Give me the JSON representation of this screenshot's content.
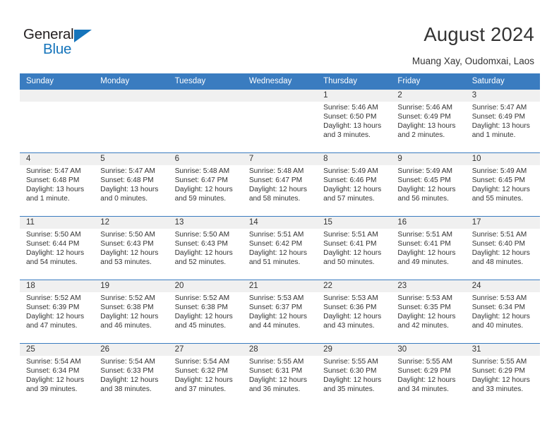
{
  "brand": {
    "name_top": "General",
    "name_bottom": "Blue",
    "accent_color": "#1574bb",
    "triangle_icon": "triangle-logo-icon"
  },
  "header": {
    "title": "August 2024",
    "subtitle": "Muang Xay, Oudomxai, Laos"
  },
  "theme": {
    "header_bg": "#3a7cc0",
    "daynum_band_bg": "#f0f0f0",
    "text": "#333333",
    "row_divider": "#3a7cc0"
  },
  "weekday_headers": [
    "Sunday",
    "Monday",
    "Tuesday",
    "Wednesday",
    "Thursday",
    "Friday",
    "Saturday"
  ],
  "labels": {
    "sunrise_prefix": "Sunrise:",
    "sunset_prefix": "Sunset:",
    "daylight_prefix": "Daylight:"
  },
  "weeks": [
    [
      {
        "day": "",
        "sunrise": "",
        "sunset": "",
        "daylight": "",
        "empty": true
      },
      {
        "day": "",
        "sunrise": "",
        "sunset": "",
        "daylight": "",
        "empty": true
      },
      {
        "day": "",
        "sunrise": "",
        "sunset": "",
        "daylight": "",
        "empty": true
      },
      {
        "day": "",
        "sunrise": "",
        "sunset": "",
        "daylight": "",
        "empty": true
      },
      {
        "day": "1",
        "sunrise": "Sunrise: 5:46 AM",
        "sunset": "Sunset: 6:50 PM",
        "daylight": "Daylight: 13 hours and 3 minutes.",
        "empty": false
      },
      {
        "day": "2",
        "sunrise": "Sunrise: 5:46 AM",
        "sunset": "Sunset: 6:49 PM",
        "daylight": "Daylight: 13 hours and 2 minutes.",
        "empty": false
      },
      {
        "day": "3",
        "sunrise": "Sunrise: 5:47 AM",
        "sunset": "Sunset: 6:49 PM",
        "daylight": "Daylight: 13 hours and 1 minute.",
        "empty": false
      }
    ],
    [
      {
        "day": "4",
        "sunrise": "Sunrise: 5:47 AM",
        "sunset": "Sunset: 6:48 PM",
        "daylight": "Daylight: 13 hours and 1 minute.",
        "empty": false
      },
      {
        "day": "5",
        "sunrise": "Sunrise: 5:47 AM",
        "sunset": "Sunset: 6:48 PM",
        "daylight": "Daylight: 13 hours and 0 minutes.",
        "empty": false
      },
      {
        "day": "6",
        "sunrise": "Sunrise: 5:48 AM",
        "sunset": "Sunset: 6:47 PM",
        "daylight": "Daylight: 12 hours and 59 minutes.",
        "empty": false
      },
      {
        "day": "7",
        "sunrise": "Sunrise: 5:48 AM",
        "sunset": "Sunset: 6:47 PM",
        "daylight": "Daylight: 12 hours and 58 minutes.",
        "empty": false
      },
      {
        "day": "8",
        "sunrise": "Sunrise: 5:49 AM",
        "sunset": "Sunset: 6:46 PM",
        "daylight": "Daylight: 12 hours and 57 minutes.",
        "empty": false
      },
      {
        "day": "9",
        "sunrise": "Sunrise: 5:49 AM",
        "sunset": "Sunset: 6:45 PM",
        "daylight": "Daylight: 12 hours and 56 minutes.",
        "empty": false
      },
      {
        "day": "10",
        "sunrise": "Sunrise: 5:49 AM",
        "sunset": "Sunset: 6:45 PM",
        "daylight": "Daylight: 12 hours and 55 minutes.",
        "empty": false
      }
    ],
    [
      {
        "day": "11",
        "sunrise": "Sunrise: 5:50 AM",
        "sunset": "Sunset: 6:44 PM",
        "daylight": "Daylight: 12 hours and 54 minutes.",
        "empty": false
      },
      {
        "day": "12",
        "sunrise": "Sunrise: 5:50 AM",
        "sunset": "Sunset: 6:43 PM",
        "daylight": "Daylight: 12 hours and 53 minutes.",
        "empty": false
      },
      {
        "day": "13",
        "sunrise": "Sunrise: 5:50 AM",
        "sunset": "Sunset: 6:43 PM",
        "daylight": "Daylight: 12 hours and 52 minutes.",
        "empty": false
      },
      {
        "day": "14",
        "sunrise": "Sunrise: 5:51 AM",
        "sunset": "Sunset: 6:42 PM",
        "daylight": "Daylight: 12 hours and 51 minutes.",
        "empty": false
      },
      {
        "day": "15",
        "sunrise": "Sunrise: 5:51 AM",
        "sunset": "Sunset: 6:41 PM",
        "daylight": "Daylight: 12 hours and 50 minutes.",
        "empty": false
      },
      {
        "day": "16",
        "sunrise": "Sunrise: 5:51 AM",
        "sunset": "Sunset: 6:41 PM",
        "daylight": "Daylight: 12 hours and 49 minutes.",
        "empty": false
      },
      {
        "day": "17",
        "sunrise": "Sunrise: 5:51 AM",
        "sunset": "Sunset: 6:40 PM",
        "daylight": "Daylight: 12 hours and 48 minutes.",
        "empty": false
      }
    ],
    [
      {
        "day": "18",
        "sunrise": "Sunrise: 5:52 AM",
        "sunset": "Sunset: 6:39 PM",
        "daylight": "Daylight: 12 hours and 47 minutes.",
        "empty": false
      },
      {
        "day": "19",
        "sunrise": "Sunrise: 5:52 AM",
        "sunset": "Sunset: 6:38 PM",
        "daylight": "Daylight: 12 hours and 46 minutes.",
        "empty": false
      },
      {
        "day": "20",
        "sunrise": "Sunrise: 5:52 AM",
        "sunset": "Sunset: 6:38 PM",
        "daylight": "Daylight: 12 hours and 45 minutes.",
        "empty": false
      },
      {
        "day": "21",
        "sunrise": "Sunrise: 5:53 AM",
        "sunset": "Sunset: 6:37 PM",
        "daylight": "Daylight: 12 hours and 44 minutes.",
        "empty": false
      },
      {
        "day": "22",
        "sunrise": "Sunrise: 5:53 AM",
        "sunset": "Sunset: 6:36 PM",
        "daylight": "Daylight: 12 hours and 43 minutes.",
        "empty": false
      },
      {
        "day": "23",
        "sunrise": "Sunrise: 5:53 AM",
        "sunset": "Sunset: 6:35 PM",
        "daylight": "Daylight: 12 hours and 42 minutes.",
        "empty": false
      },
      {
        "day": "24",
        "sunrise": "Sunrise: 5:53 AM",
        "sunset": "Sunset: 6:34 PM",
        "daylight": "Daylight: 12 hours and 40 minutes.",
        "empty": false
      }
    ],
    [
      {
        "day": "25",
        "sunrise": "Sunrise: 5:54 AM",
        "sunset": "Sunset: 6:34 PM",
        "daylight": "Daylight: 12 hours and 39 minutes.",
        "empty": false
      },
      {
        "day": "26",
        "sunrise": "Sunrise: 5:54 AM",
        "sunset": "Sunset: 6:33 PM",
        "daylight": "Daylight: 12 hours and 38 minutes.",
        "empty": false
      },
      {
        "day": "27",
        "sunrise": "Sunrise: 5:54 AM",
        "sunset": "Sunset: 6:32 PM",
        "daylight": "Daylight: 12 hours and 37 minutes.",
        "empty": false
      },
      {
        "day": "28",
        "sunrise": "Sunrise: 5:55 AM",
        "sunset": "Sunset: 6:31 PM",
        "daylight": "Daylight: 12 hours and 36 minutes.",
        "empty": false
      },
      {
        "day": "29",
        "sunrise": "Sunrise: 5:55 AM",
        "sunset": "Sunset: 6:30 PM",
        "daylight": "Daylight: 12 hours and 35 minutes.",
        "empty": false
      },
      {
        "day": "30",
        "sunrise": "Sunrise: 5:55 AM",
        "sunset": "Sunset: 6:29 PM",
        "daylight": "Daylight: 12 hours and 34 minutes.",
        "empty": false
      },
      {
        "day": "31",
        "sunrise": "Sunrise: 5:55 AM",
        "sunset": "Sunset: 6:29 PM",
        "daylight": "Daylight: 12 hours and 33 minutes.",
        "empty": false
      }
    ]
  ]
}
